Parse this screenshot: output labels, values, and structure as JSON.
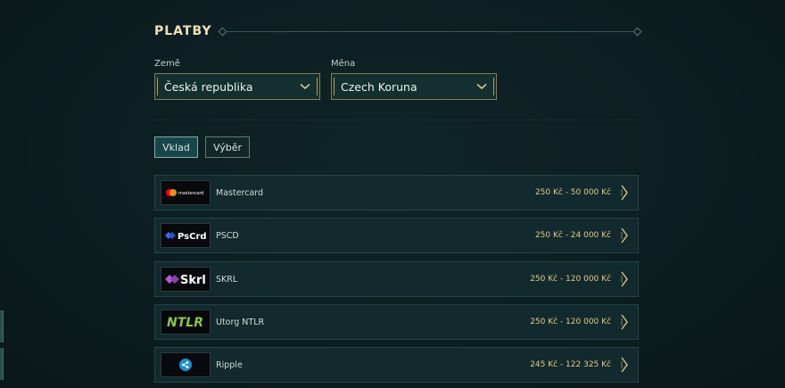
{
  "section": {
    "title": "PLATBY"
  },
  "filters": {
    "country_label": "Země",
    "country_value": "Česká republika",
    "currency_label": "Měna",
    "currency_value": "Czech Koruna"
  },
  "tabs": [
    {
      "label": "Vklad",
      "active": true
    },
    {
      "label": "Výběr",
      "active": false
    }
  ],
  "methods": [
    {
      "name": "Mastercard",
      "range": "250 Kč - 50 000 Kč",
      "logo_text": "mastercard",
      "icon": "mastercard-logo-icon"
    },
    {
      "name": "PSCD",
      "range": "250 Kč - 24 000 Kč",
      "logo_text": "PsCrd",
      "icon": "paysafecard-logo-icon"
    },
    {
      "name": "SKRL",
      "range": "250 Kč - 120 000 Kč",
      "logo_text": "Skrl",
      "icon": "skrill-logo-icon"
    },
    {
      "name": "Utorg NTLR",
      "range": "250 Kč - 120 000 Kč",
      "logo_text": "NTLR",
      "icon": "neteller-logo-icon"
    },
    {
      "name": "Ripple",
      "range": "245 Kč - 122 325 Kč",
      "logo_text": "",
      "icon": "ripple-logo-icon"
    }
  ],
  "colors": {
    "background": "#0c1f22",
    "accent_gold": "#e6c986",
    "row_bg": "#122a2d",
    "active_tab": "#17464a",
    "ntlr_green": "#8bc34a",
    "skrill_purple": "#b25ad6"
  }
}
